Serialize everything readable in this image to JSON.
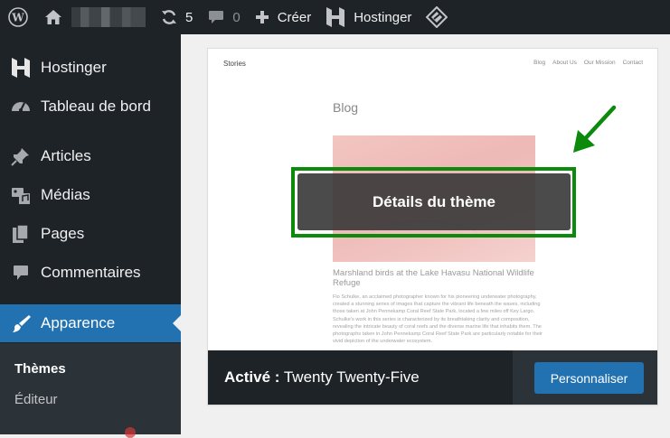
{
  "adminbar": {
    "updates_count": "5",
    "comments_count": "0",
    "new_label": "Créer",
    "hostinger_label": "Hostinger"
  },
  "sidebar": {
    "items": [
      {
        "label": "Hostinger",
        "icon": "hostinger-icon"
      },
      {
        "label": "Tableau de bord",
        "icon": "dashboard-icon"
      },
      {
        "label": "Articles",
        "icon": "pin-icon"
      },
      {
        "label": "Médias",
        "icon": "media-icon"
      },
      {
        "label": "Pages",
        "icon": "pages-icon"
      },
      {
        "label": "Commentaires",
        "icon": "comment-icon"
      },
      {
        "label": "Apparence",
        "icon": "brush-icon",
        "active": true
      }
    ],
    "submenu": [
      {
        "label": "Thèmes",
        "current": true
      },
      {
        "label": "Éditeur",
        "current": false
      }
    ]
  },
  "theme": {
    "preview": {
      "site_title": "Stories",
      "nav": [
        "Blog",
        "About Us",
        "Our Mission",
        "Contact"
      ],
      "heading": "Blog",
      "post_title": "Marshland birds at the Lake Havasu National Wildlife Refuge",
      "excerpt": "Flo Schulke, an acclaimed photographer known for his pioneering underwater photography, created a stunning series of images that capture the vibrant life beneath the waves, including those taken at John Pennekamp Coral Reef State Park, located a few miles off Key Largo. Schulke's work in this series is characterized by its breathtaking clarity and composition, revealing the intricate beauty of coral reefs and the diverse marine life that inhabits them. The photographs taken in John Pennekamp Coral Reef State Park are particularly notable for their vivid depiction of the underwater ecosystem."
    },
    "details_label": "Détails du thème",
    "active_prefix": "Activé :",
    "active_name": "Twenty Twenty-Five",
    "customize_label": "Personnaliser"
  },
  "colors": {
    "admin_dark": "#1d2327",
    "accent_blue": "#2271b1",
    "highlight_green": "#0b8a0b"
  }
}
